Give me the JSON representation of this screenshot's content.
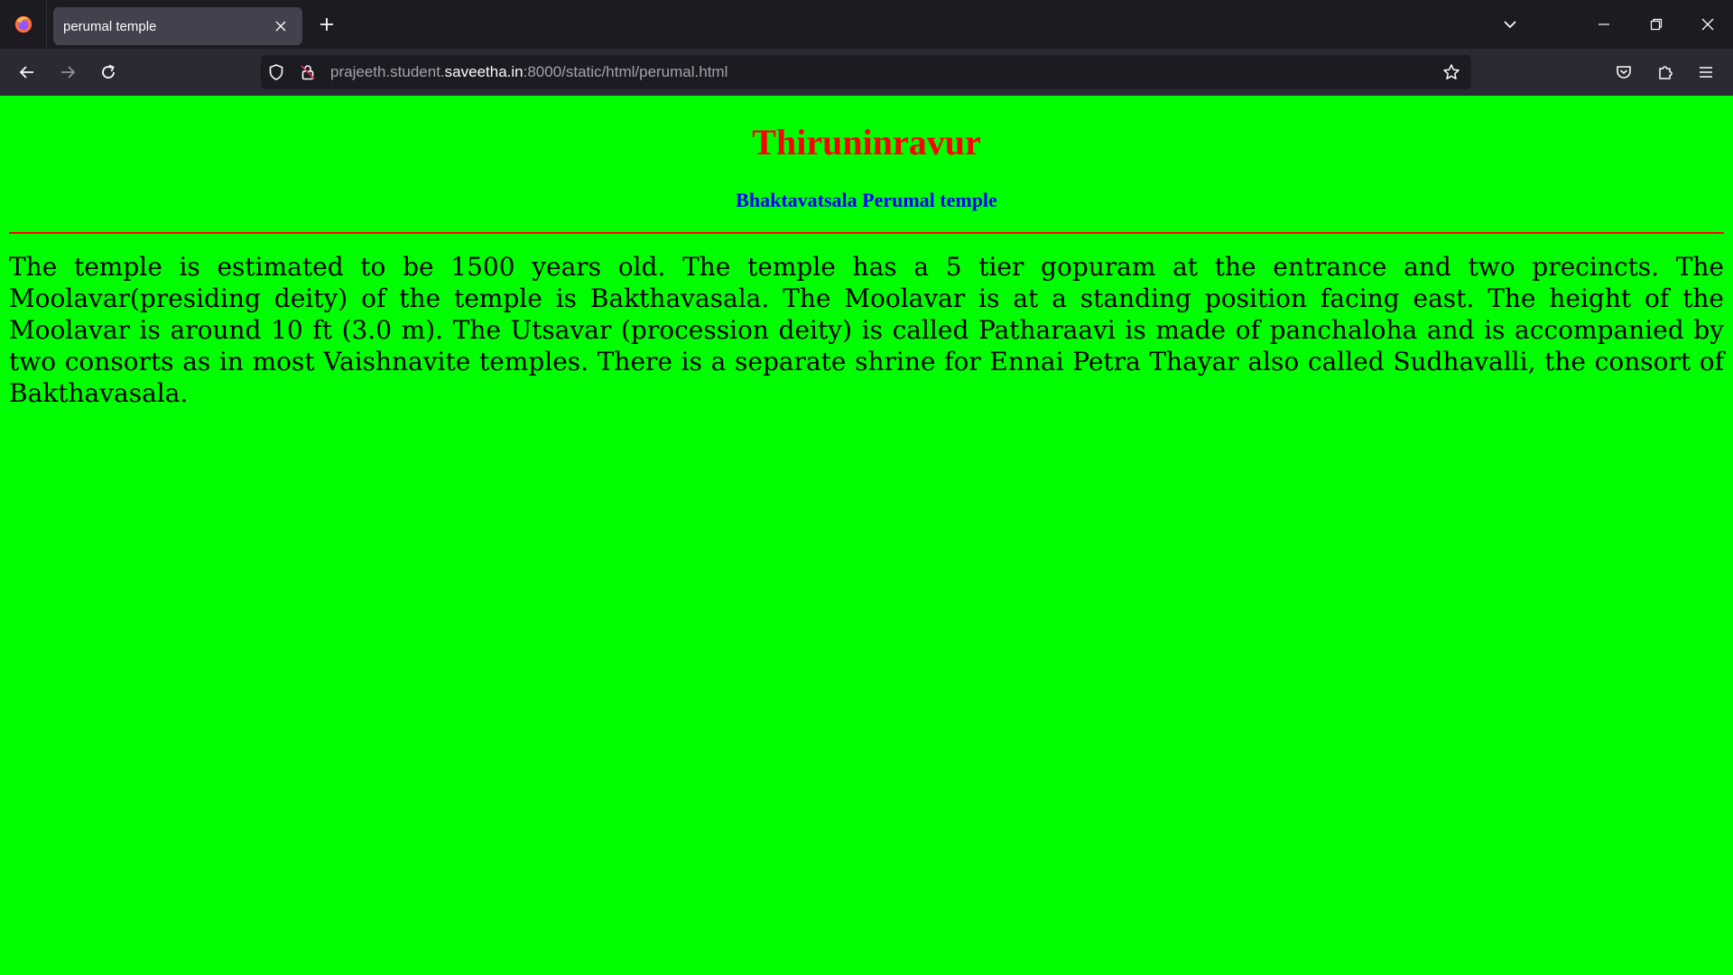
{
  "browser": {
    "tab": {
      "title": "perumal temple"
    },
    "url": {
      "prefix": "prajeeth.student.",
      "host": "saveetha.in",
      "suffix": ":8000/static/html/perumal.html"
    },
    "icons": {
      "logo": "firefox-logo",
      "close_tab": "close-icon",
      "new_tab": "plus-icon",
      "tab_list": "chevron-down-icon",
      "minimize": "minimize-icon",
      "restore": "restore-icon",
      "close_window": "close-icon",
      "back": "back-arrow-icon",
      "forward": "forward-arrow-icon",
      "reload": "reload-icon",
      "tracking": "shield-icon",
      "security": "lock-icon",
      "bookmark": "star-icon",
      "pocket": "pocket-icon",
      "extensions": "puzzle-icon",
      "menu": "hamburger-menu-icon"
    },
    "colors": {
      "tabstrip": "#1c1b22",
      "navbar": "#2b2a33",
      "active_tab": "#42414d"
    }
  },
  "page": {
    "heading": "Thiruninravur",
    "subheading": "Bhaktavatsala Perumal temple",
    "paragraph": "The temple is estimated to be 1500 years old. The temple has a 5 tier gopuram at the entrance and two precincts. The Moolavar(presiding deity) of the temple is Bakthavasala. The Moolavar is at a standing position facing east. The height of the Moolavar is around 10 ft (3.0 m). The Utsavar (procession deity) is called Patharaavi is made of panchaloha and is accompanied by two consorts as in most Vaishnavite temples. There is a separate shrine for Ennai Petra Thayar also called Sudhavalli, the consort of Bakthavasala.",
    "colors": {
      "background": "#00ff00",
      "heading": "#ff0000",
      "subheading": "#0000ff",
      "rule": "#ff0000",
      "text": "#000000"
    }
  }
}
